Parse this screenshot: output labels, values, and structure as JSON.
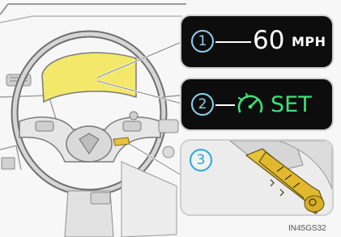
{
  "callouts": [
    {
      "number": "1",
      "value": "60",
      "unit": "MPH",
      "icon": "speed-readout"
    },
    {
      "number": "2",
      "value": "SET",
      "icon": "cruise-control-icon",
      "value_color": "#3fe07a"
    },
    {
      "number": "3",
      "icon": "cruise-control-lever"
    }
  ],
  "figure_code": "IN45GS32",
  "colors": {
    "highlight": "#f3e86a",
    "lever": "#e7c23a",
    "callout_number": "#8fd3f0"
  }
}
